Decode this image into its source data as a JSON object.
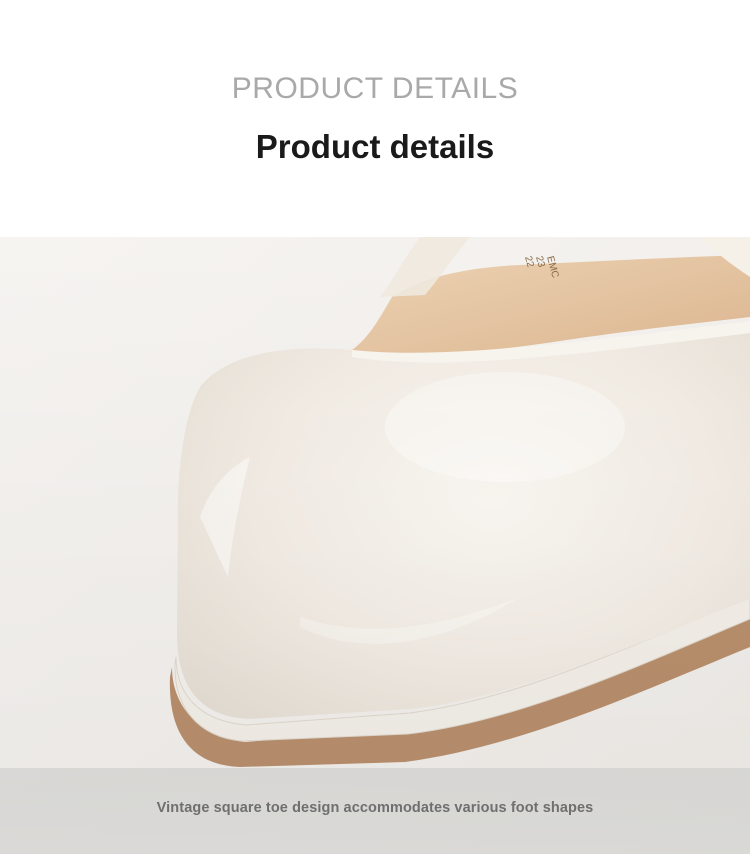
{
  "header": {
    "eyebrow": "PRODUCT DETAILS",
    "title": "Product details"
  },
  "photo": {
    "subject": "shoe-toe-closeup",
    "insole_print": [
      "22",
      "23",
      "EMC"
    ]
  },
  "caption": {
    "text": "Vintage square toe design accommodates various foot shapes"
  },
  "colors": {
    "background": "#f4f2ef",
    "leather": "#f1ece4",
    "lining": "#e3c39f",
    "sole": "#b98f6d",
    "caption_band": "#d3d3d1"
  }
}
